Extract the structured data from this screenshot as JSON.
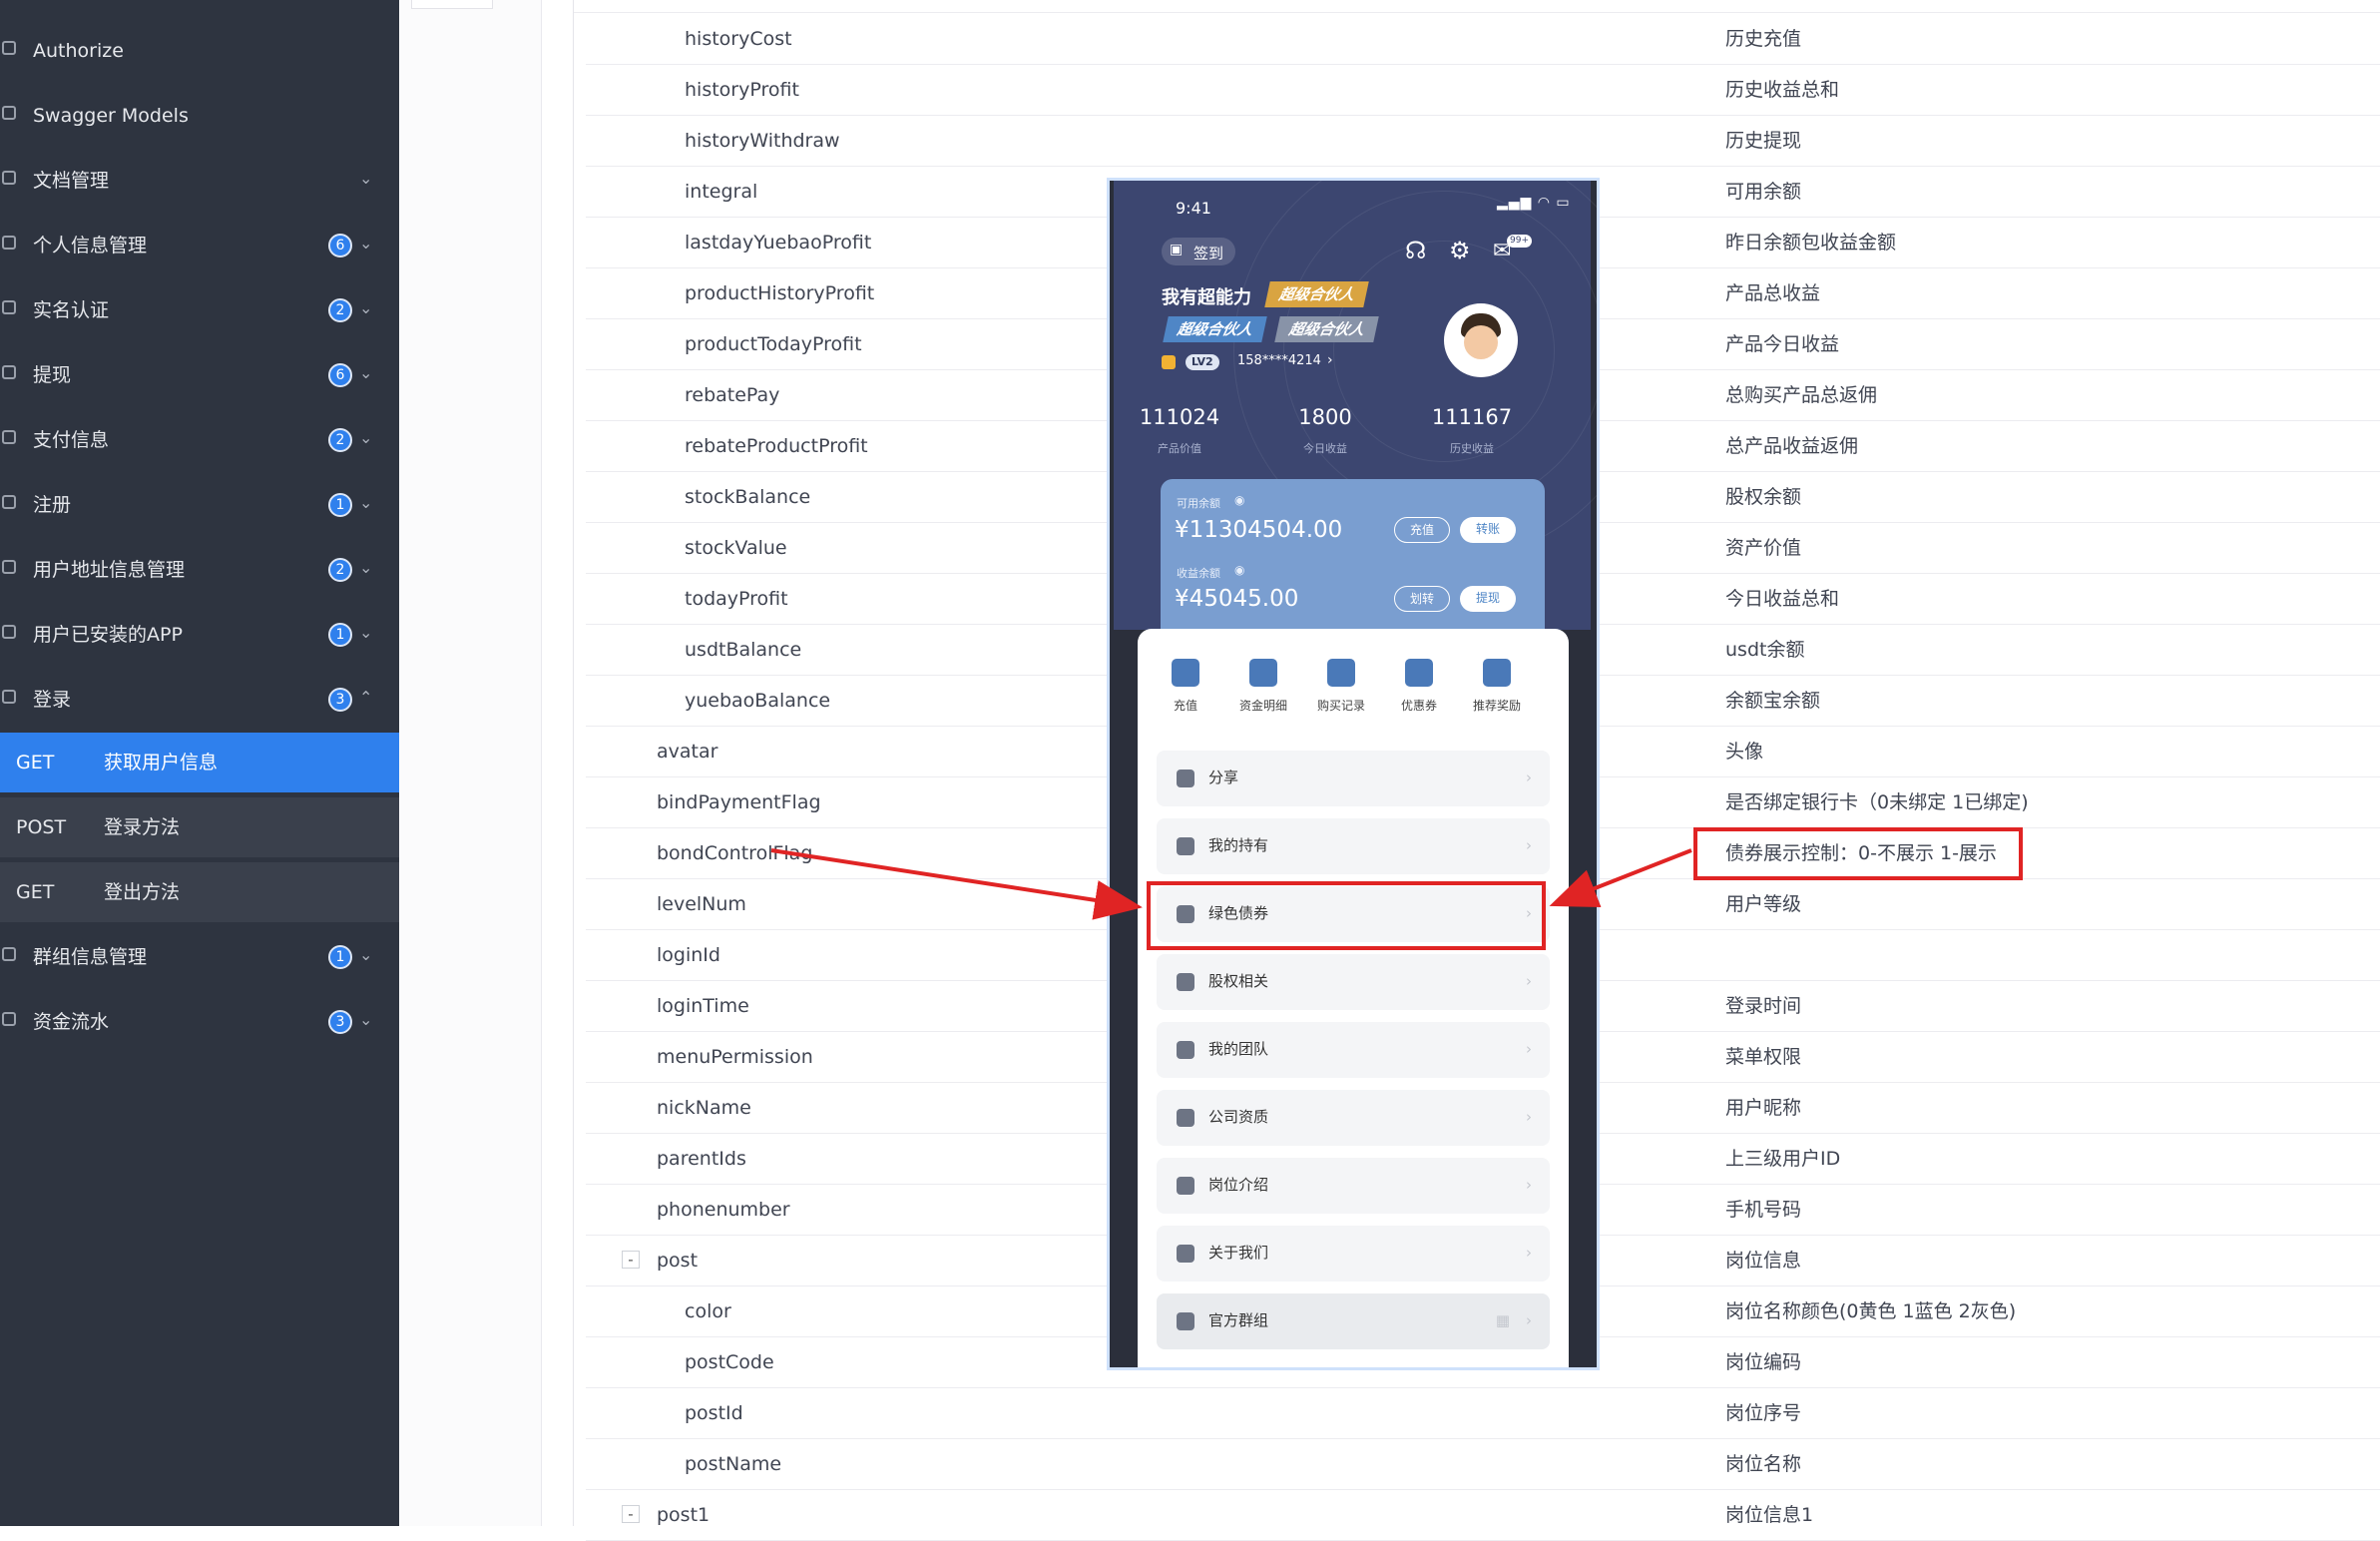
{
  "sidebar": {
    "items": [
      {
        "label": "Authorize"
      },
      {
        "label": "Swagger Models"
      },
      {
        "label": "文档管理"
      },
      {
        "label": "个人信息管理",
        "badge": "6"
      },
      {
        "label": "实名认证",
        "badge": "2"
      },
      {
        "label": "提现",
        "badge": "6"
      },
      {
        "label": "支付信息",
        "badge": "2"
      },
      {
        "label": "注册",
        "badge": "1"
      },
      {
        "label": "用户地址信息管理",
        "badge": "2"
      },
      {
        "label": "用户已安装的APP",
        "badge": "1"
      },
      {
        "label": "登录",
        "badge": "3"
      }
    ],
    "sub_items": [
      {
        "method": "GET",
        "label": "获取用户信息",
        "active": true
      },
      {
        "method": "POST",
        "label": "登录方法"
      },
      {
        "method": "GET",
        "label": "登出方法"
      }
    ],
    "items_after": [
      {
        "label": "群组信息管理",
        "badge": "1"
      },
      {
        "label": "资金流水",
        "badge": "3"
      }
    ]
  },
  "fields": [
    {
      "name": "historyCost",
      "desc": "历史充值"
    },
    {
      "name": "historyProfit",
      "desc": "历史收益总和"
    },
    {
      "name": "historyWithdraw",
      "desc": "历史提现"
    },
    {
      "name": "integral",
      "desc": "可用余额"
    },
    {
      "name": "lastdayYuebaoProfit",
      "desc": "昨日余额包收益金额"
    },
    {
      "name": "productHistoryProfit",
      "desc": "产品总收益"
    },
    {
      "name": "productTodayProfit",
      "desc": "产品今日收益"
    },
    {
      "name": "rebatePay",
      "desc": "总购买产品总返佣"
    },
    {
      "name": "rebateProductProfit",
      "desc": "总产品收益返佣"
    },
    {
      "name": "stockBalance",
      "desc": "股权余额"
    },
    {
      "name": "stockValue",
      "desc": "资产价值"
    },
    {
      "name": "todayProfit",
      "desc": "今日收益总和"
    },
    {
      "name": "usdtBalance",
      "desc": "usdt余额"
    },
    {
      "name": "yuebaoBalance",
      "desc": "余额宝余额"
    },
    {
      "name": "avatar",
      "desc": "头像"
    },
    {
      "name": "bindPaymentFlag",
      "desc": "是否绑定银行卡（0未绑定 1已绑定)"
    },
    {
      "name": "bondControlFlag",
      "desc": "债券展示控制：0-不展示 1-展示"
    },
    {
      "name": "levelNum",
      "desc": "用户等级"
    },
    {
      "name": "loginId",
      "desc": ""
    },
    {
      "name": "loginTime",
      "desc": "登录时间"
    },
    {
      "name": "menuPermission",
      "desc": "菜单权限"
    },
    {
      "name": "nickName",
      "desc": "用户昵称"
    },
    {
      "name": "parentIds",
      "desc": "上三级用户ID"
    },
    {
      "name": "phonenumber",
      "desc": "手机号码"
    },
    {
      "name": "post",
      "desc": "岗位信息",
      "toggle": "-"
    },
    {
      "name": "color",
      "desc": "岗位名称颜色(0黄色 1蓝色 2灰色)"
    },
    {
      "name": "postCode",
      "desc": "岗位编码"
    },
    {
      "name": "postId",
      "desc": "岗位序号"
    },
    {
      "name": "postName",
      "desc": "岗位名称"
    },
    {
      "name": "post1",
      "desc": "岗位信息1",
      "toggle": "-"
    }
  ],
  "phone": {
    "time": "9:41",
    "signin": "签到",
    "notif_badge": "99+",
    "headline": "我有超能力",
    "tags": [
      "超级合伙人",
      "超级合伙人",
      "超级合伙人"
    ],
    "level": "LV2",
    "phone_masked": "158****4214",
    "stats": [
      {
        "value": "111024",
        "label": "产品价值"
      },
      {
        "value": "1800",
        "label": "今日收益"
      },
      {
        "value": "111167",
        "label": "历史收益"
      }
    ],
    "balance": {
      "available_label": "可用余额",
      "available_value": "¥11304504.00",
      "btn_recharge": "充值",
      "btn_transfer": "转账",
      "income_label": "收益余额",
      "income_value": "¥45045.00",
      "btn_move": "划转",
      "btn_withdraw": "提现"
    },
    "quick": [
      "充值",
      "资金明细",
      "购买记录",
      "优惠券",
      "推荐奖励"
    ],
    "menu": [
      "分享",
      "我的持有",
      "绿色债券",
      "股权相关",
      "我的团队",
      "公司资质",
      "岗位介绍",
      "关于我们",
      "官方群组"
    ]
  },
  "colors": {
    "sidebar_bg": "#2e3440",
    "active": "#2f80ed",
    "highlight": "#e02424"
  }
}
